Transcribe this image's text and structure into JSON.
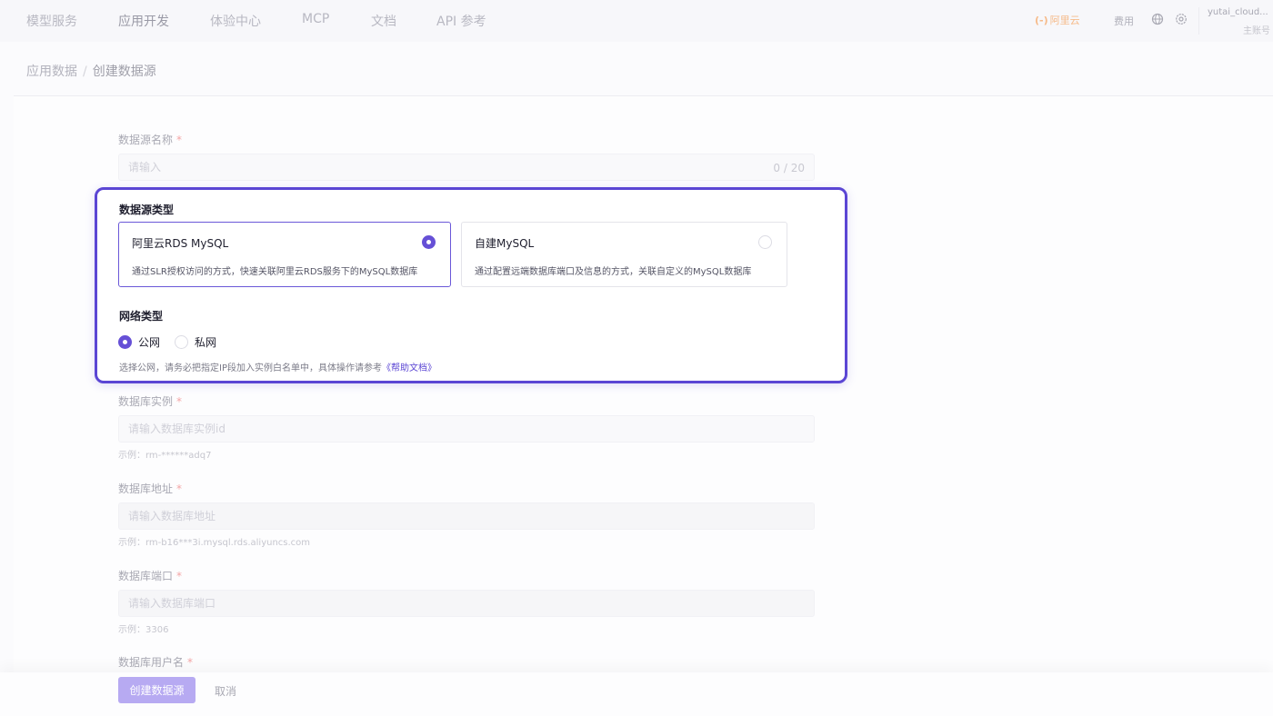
{
  "topnav": {
    "items": [
      "模型服务",
      "应用开发",
      "体验中心",
      "MCP",
      "文档",
      "API 参考"
    ],
    "brand": {
      "mark": "(-)",
      "name": "阿里云",
      "color": "#ff6a00"
    },
    "fee_label": "费用",
    "icons": [
      "globe-icon",
      "gear-icon"
    ],
    "user_name": "yutai_cloud...",
    "user_role": "主账号"
  },
  "breadcrumb": {
    "parent": "应用数据",
    "separator": "/",
    "current": "创建数据源"
  },
  "form": {
    "name": {
      "label": "数据源名称",
      "required": "*",
      "placeholder": "请输入",
      "counter": "0 / 20"
    },
    "source_type": {
      "title": "数据源类型",
      "options": [
        {
          "title": "阿里云RDS MySQL",
          "desc": "通过SLR授权访问的方式，快速关联阿里云RDS服务下的MySQL数据库",
          "selected": true
        },
        {
          "title": "自建MySQL",
          "desc": "通过配置远端数据库端口及信息的方式，关联自定义的MySQL数据库",
          "selected": false
        }
      ]
    },
    "network": {
      "title": "网络类型",
      "options": [
        {
          "label": "公网",
          "selected": true
        },
        {
          "label": "私网",
          "selected": false
        }
      ],
      "note": "选择公网，请务必把指定IP段加入实例白名单中，具体操作请参考",
      "link": "《帮助文档》"
    },
    "instance": {
      "label": "数据库实例",
      "required": "*",
      "placeholder": "请输入数据库实例id",
      "hint": "示例：rm-******adq7"
    },
    "address": {
      "label": "数据库地址",
      "required": "*",
      "placeholder": "请输入数据库地址",
      "hint": "示例：rm-b16***3i.mysql.rds.aliyuncs.com"
    },
    "port": {
      "label": "数据库端口",
      "required": "*",
      "placeholder": "请输入数据库端口",
      "hint": "示例：3306"
    },
    "username": {
      "label": "数据库用户名",
      "required": "*"
    }
  },
  "footer": {
    "submit": "创建数据源",
    "cancel": "取消"
  },
  "colors": {
    "accent": "#5b46d4",
    "highlight_border": "#5b46d4",
    "required": "#f4a6a6"
  }
}
